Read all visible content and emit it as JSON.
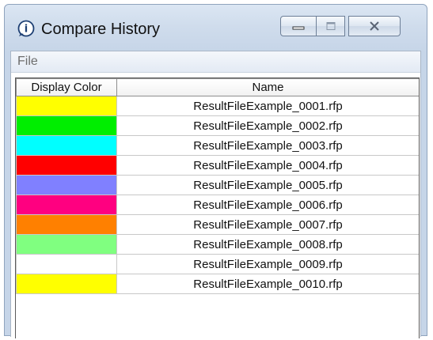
{
  "window": {
    "title": "Compare History",
    "icon": "info-question-icon"
  },
  "menu": {
    "file_label": "File"
  },
  "table": {
    "columns": [
      "Display Color",
      "Name"
    ],
    "rows": [
      {
        "color": "#ffff00",
        "name": "ResultFileExample_0001.rfp"
      },
      {
        "color": "#00ee00",
        "name": "ResultFileExample_0002.rfp"
      },
      {
        "color": "#00ffff",
        "name": "ResultFileExample_0003.rfp"
      },
      {
        "color": "#ff0000",
        "name": "ResultFileExample_0004.rfp"
      },
      {
        "color": "#8080ff",
        "name": "ResultFileExample_0005.rfp"
      },
      {
        "color": "#ff0080",
        "name": "ResultFileExample_0006.rfp"
      },
      {
        "color": "#ff8000",
        "name": "ResultFileExample_0007.rfp"
      },
      {
        "color": "#80ff80",
        "name": "ResultFileExample_0008.rfp"
      },
      {
        "color": "#ffffff",
        "name": "ResultFileExample_0009.rfp"
      },
      {
        "color": "#ffff00",
        "name": "ResultFileExample_0010.rfp"
      }
    ]
  }
}
